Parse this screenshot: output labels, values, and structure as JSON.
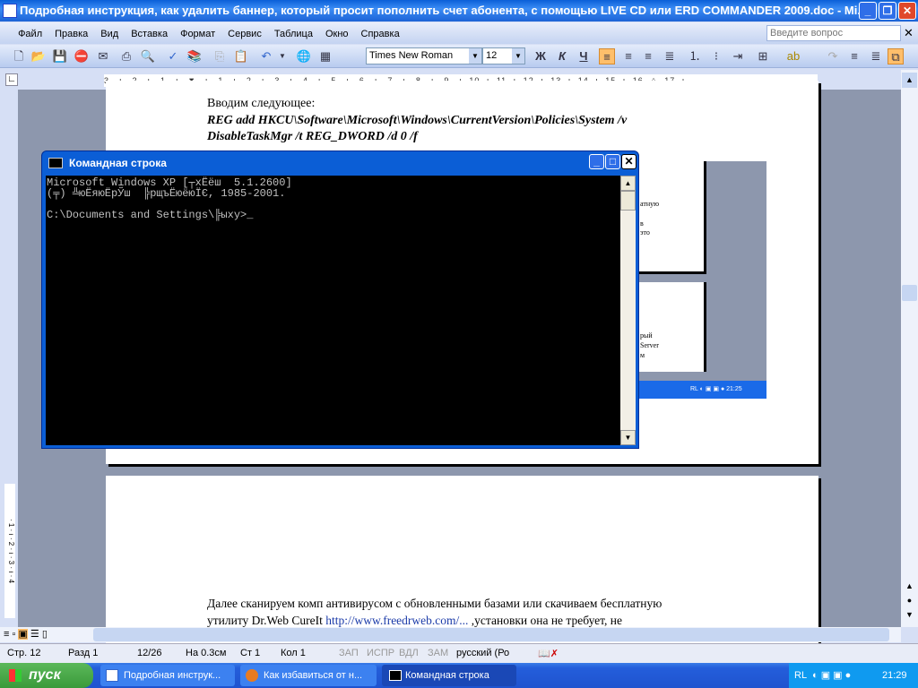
{
  "window": {
    "title": "Подробная инструкция, как удалить баннер, который просит пополнить счет абонента, с помощью LIVE CD или ERD COMMANDER 2009.doc - Mi..."
  },
  "menu": [
    "Файл",
    "Правка",
    "Вид",
    "Вставка",
    "Формат",
    "Сервис",
    "Таблица",
    "Окно",
    "Справка"
  ],
  "ask_placeholder": "Введите вопрос",
  "toolbar": {
    "font": "Times New Roman",
    "size": "12",
    "bold": "Ж",
    "italic": "К",
    "underline": "Ч"
  },
  "ruler": "3 · ı · 2 · ı · 1 · ı · ⧗ · ı · 1 · ı · 2 · ı · 3 · ı · 4 · ı · 5 · ı · 6 · ı · 7 · ı · 8 · ı · 9 · ı ·10· ı ·11· ı ·12· ı ·13· ı ·14· ı ·15· ı ·16· △ ·17· ı ·",
  "document": {
    "line_intro": "Вводим следующее:",
    "cmd_line1": "REG add HKCU\\Software\\Microsoft\\Windows\\CurrentVersion\\Policies\\System /v",
    "cmd_line2": "DisableTaskMgr /t REG_DWORD /d 0 /f",
    "para1": "Далее сканируем комп антивирусом с обновленными базами или скачиваем бесплатную",
    "para2_a": "утилиту Dr.Web CureIt ",
    "para2_link": "http://www.freedrweb.com/...",
    "para2_b": " ,установки она не требует, не",
    "embedded_fragments": [
      "атную",
      "в",
      "это",
      "рый",
      "Server",
      "м"
    ],
    "embedded_tray": "RL",
    "embedded_time": "21:25"
  },
  "cmd": {
    "title": "Командная строка",
    "lines": [
      "Microsoft Windows XP [┬хЁёш  5.1.2600]",
      "(╤) ╩юЁяюЁрЎш  ╠рщъЁюёюЇЄ, 1985-2001.",
      "",
      "C:\\Documents and Settings\\╠ыху>_"
    ]
  },
  "status": {
    "page": "Стр. 12",
    "section": "Разд 1",
    "pages": "12/26",
    "at": "На 0.3см",
    "line": "Ст 1",
    "col": "Кол 1",
    "rec": "ЗАП",
    "trk": "ИСПР",
    "ext": "ВДЛ",
    "ovr": "ЗАМ",
    "lang": "русский (Ро"
  },
  "taskbar": {
    "start": "пуск",
    "tasks": [
      "Подробная инструк...",
      "Как избавиться от н...",
      "Командная строка"
    ],
    "lang": "RL",
    "time": "21:29"
  }
}
